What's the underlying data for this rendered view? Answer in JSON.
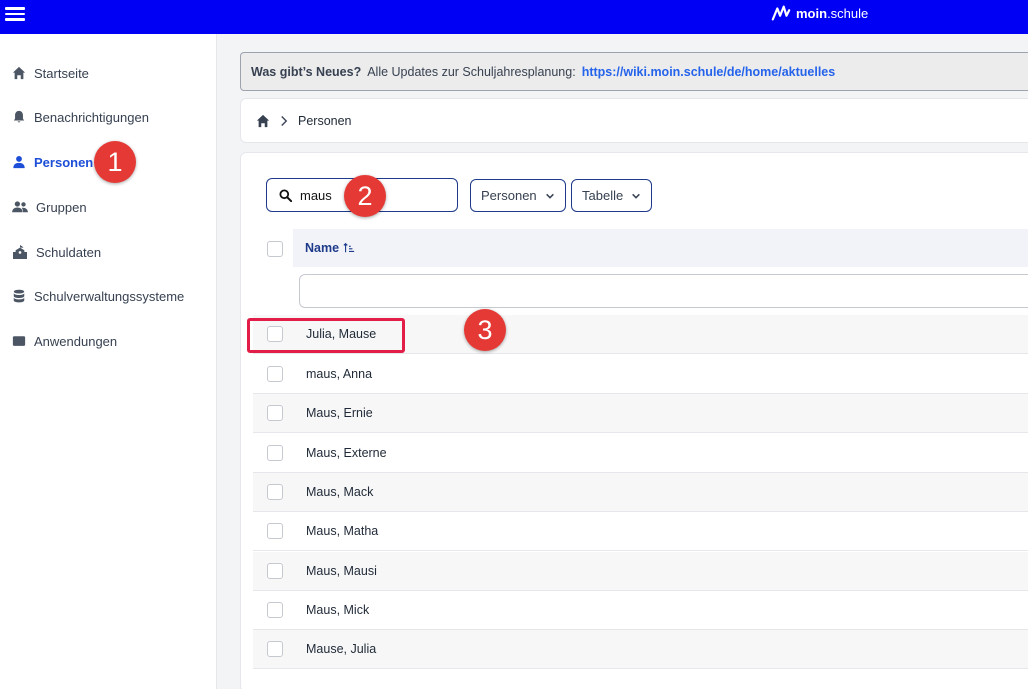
{
  "brand": {
    "name_bold": "moin",
    "name_rest": ".schule"
  },
  "sidebar": {
    "items": [
      {
        "label": "Startseite",
        "icon": "home-icon",
        "active": false
      },
      {
        "label": "Benachrichtigungen",
        "icon": "bell-icon",
        "active": false
      },
      {
        "label": "Personen",
        "icon": "person-icon",
        "active": true
      },
      {
        "label": "Gruppen",
        "icon": "users-icon",
        "active": false
      },
      {
        "label": "Schuldaten",
        "icon": "school-icon",
        "active": false
      },
      {
        "label": "Schulverwaltungssysteme",
        "icon": "database-icon",
        "active": false
      },
      {
        "label": "Anwendungen",
        "icon": "window-icon",
        "active": false
      }
    ]
  },
  "news": {
    "title": "Was gibt’s Neues?",
    "text": "Alle Updates zur Schuljahresplanung:",
    "link": "https://wiki.moin.schule/de/home/aktuelles"
  },
  "breadcrumb": {
    "current": "Personen"
  },
  "search": {
    "value": "maus"
  },
  "filters": {
    "type_label": "Personen",
    "view_label": "Tabelle"
  },
  "table": {
    "column_name": "Name",
    "rows": [
      "Julia, Mause",
      "maus, Anna",
      "Maus, Ernie",
      "Maus, Externe",
      "Maus, Mack",
      "Maus, Matha",
      "Maus, Mausi",
      "Maus, Mick",
      "Mause, Julia"
    ]
  },
  "annotations": {
    "step1": "1",
    "step2": "2",
    "step3": "3"
  },
  "colors": {
    "topbar": "#0000f5",
    "accent": "#1d4ed8",
    "badge": "#e53935",
    "highlight": "#e11d48"
  }
}
